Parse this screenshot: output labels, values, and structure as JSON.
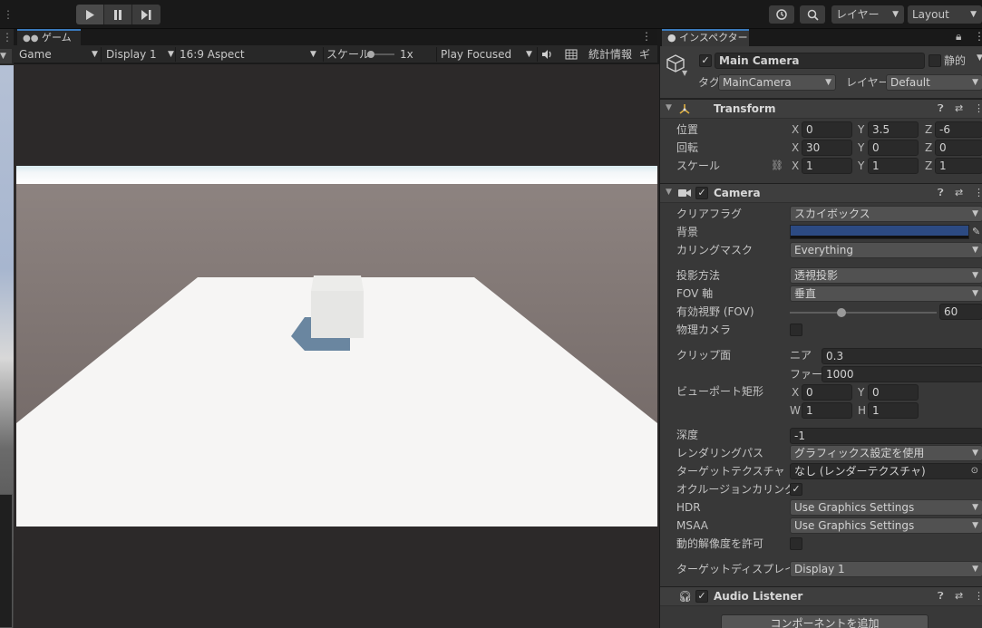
{
  "toolbar": {
    "layer_label": "レイヤー",
    "layout_label": "Layout"
  },
  "game": {
    "tab_label": "ゲーム",
    "mode": "Game",
    "display": "Display 1",
    "aspect": "16:9 Aspect",
    "scale_label": "スケール",
    "scale_value": "1x",
    "play_mode": "Play Focused",
    "stats_label": "統計情報",
    "gizmos_label": "ギズ"
  },
  "inspector": {
    "tab_label": "インスペクター",
    "object": {
      "name": "Main Camera",
      "static_label": "静的",
      "tag_label": "タグ",
      "tag_value": "MainCamera",
      "layer_label": "レイヤー",
      "layer_value": "Default"
    },
    "transform": {
      "title": "Transform",
      "position_label": "位置",
      "rotation_label": "回転",
      "scale_label": "スケール",
      "position": {
        "x": "0",
        "y": "3.5",
        "z": "-6"
      },
      "rotation": {
        "x": "30",
        "y": "0",
        "z": "0"
      },
      "scale": {
        "x": "1",
        "y": "1",
        "z": "1"
      }
    },
    "camera": {
      "title": "Camera",
      "clear_flags_label": "クリアフラグ",
      "clear_flags_value": "スカイボックス",
      "background_label": "背景",
      "background_color": "#2c4a82",
      "culling_mask_label": "カリングマスク",
      "culling_mask_value": "Everything",
      "projection_label": "投影方法",
      "projection_value": "透視投影",
      "fov_axis_label": "FOV 軸",
      "fov_axis_value": "垂直",
      "fov_label": "有効視野 (FOV)",
      "fov_value": "60",
      "physical_label": "物理カメラ",
      "clipping_label": "クリップ面",
      "near_label": "ニア",
      "near_value": "0.3",
      "far_label": "ファー",
      "far_value": "1000",
      "viewport_label": "ビューポート矩形",
      "viewport": {
        "x": "0",
        "y": "0",
        "w": "1",
        "h": "1"
      },
      "depth_label": "深度",
      "depth_value": "-1",
      "rendering_path_label": "レンダリングパス",
      "rendering_path_value": "グラフィックス設定を使用",
      "target_texture_label": "ターゲットテクスチャ",
      "target_texture_value": "なし (レンダーテクスチャ)",
      "occlusion_label": "オクルージョンカリング",
      "hdr_label": "HDR",
      "hdr_value": "Use Graphics Settings",
      "msaa_label": "MSAA",
      "msaa_value": "Use Graphics Settings",
      "dynamic_res_label": "動的解像度を許可",
      "target_display_label": "ターゲットディスプレイ",
      "target_display_value": "Display 1"
    },
    "audio_listener": {
      "title": "Audio Listener"
    },
    "add_component_label": "コンポーネントを追加"
  }
}
